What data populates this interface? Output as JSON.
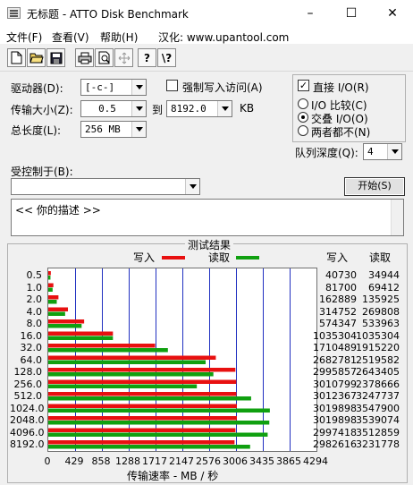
{
  "window": {
    "title": "无标题 - ATTO Disk Benchmark",
    "minimize_glyph": "–",
    "maximize_glyph": "☐",
    "close_glyph": "✕"
  },
  "menu": {
    "file": "文件(F)",
    "view": "查看(V)",
    "help": "帮助(H)",
    "localized": "汉化: www.upantool.com"
  },
  "toolbar": {
    "icons": [
      "new-file-icon",
      "open-folder-icon",
      "save-icon",
      "print-icon",
      "print-preview-icon",
      "move-icon",
      "help-icon",
      "context-help-icon"
    ],
    "help_glyph": "?",
    "context_help_glyph": "\\?"
  },
  "settings": {
    "drive_label": "驱动器(D):",
    "drive_value": "[-c-]",
    "force_write_label": "强制写入访问(A)",
    "force_write_checked": false,
    "direct_io_label": "直接 I/O(R)",
    "direct_io_checked": true,
    "transfer_size_label": "传输大小(Z):",
    "transfer_from": "0.5",
    "to_label": "到",
    "transfer_to": "8192.0",
    "kb_label": "KB",
    "total_length_label": "总长度(L):",
    "total_length_value": "256 MB",
    "io_compare_label": "I/O 比较(C)",
    "io_overlap_label": "交叠 I/O(O)",
    "neither_label": "两者都不(N)",
    "selected_mode": "overlap",
    "queue_depth_label": "队列深度(Q):",
    "queue_depth_value": "4",
    "controlled_by_label": "受控制于(B):",
    "controlled_by_value": "",
    "start_button": "开始(S)",
    "description": "<<  你的描述  >>"
  },
  "results": {
    "title": "测试结果",
    "write_legend": "写入",
    "read_legend": "读取",
    "write_header": "写入",
    "read_header": "读取",
    "write_color": "#e81010",
    "read_color": "#10a010",
    "x_label": "传输速率 - MB / 秒"
  },
  "chart_data": {
    "type": "bar",
    "orientation": "horizontal",
    "title": "测试结果",
    "xlabel": "传输速率 - MB / 秒",
    "xlim": [
      0,
      4294
    ],
    "x_ticks": [
      "0",
      "429",
      "858",
      "1288",
      "1717",
      "2147",
      "2576",
      "3006",
      "3435",
      "3865",
      "4294"
    ],
    "categories": [
      "0.5",
      "1.0",
      "2.0",
      "4.0",
      "8.0",
      "16.0",
      "32.0",
      "64.0",
      "128.0",
      "256.0",
      "512.0",
      "1024.0",
      "2048.0",
      "4096.0",
      "8192.0"
    ],
    "grid": true,
    "legend": "top",
    "series": [
      {
        "name": "写入",
        "color": "#e81010",
        "values": [
          40730,
          81700,
          162889,
          314752,
          574347,
          1035304,
          1710489,
          2682781,
          2995857,
          3010799,
          3012367,
          3019898,
          3019898,
          2997418,
          2982616
        ]
      },
      {
        "name": "读取",
        "color": "#10a010",
        "values": [
          34944,
          69412,
          135925,
          269808,
          533963,
          1035304,
          1915220,
          2519582,
          2643405,
          2378666,
          3247737,
          3547900,
          3539074,
          3512859,
          3231778
        ]
      }
    ]
  }
}
